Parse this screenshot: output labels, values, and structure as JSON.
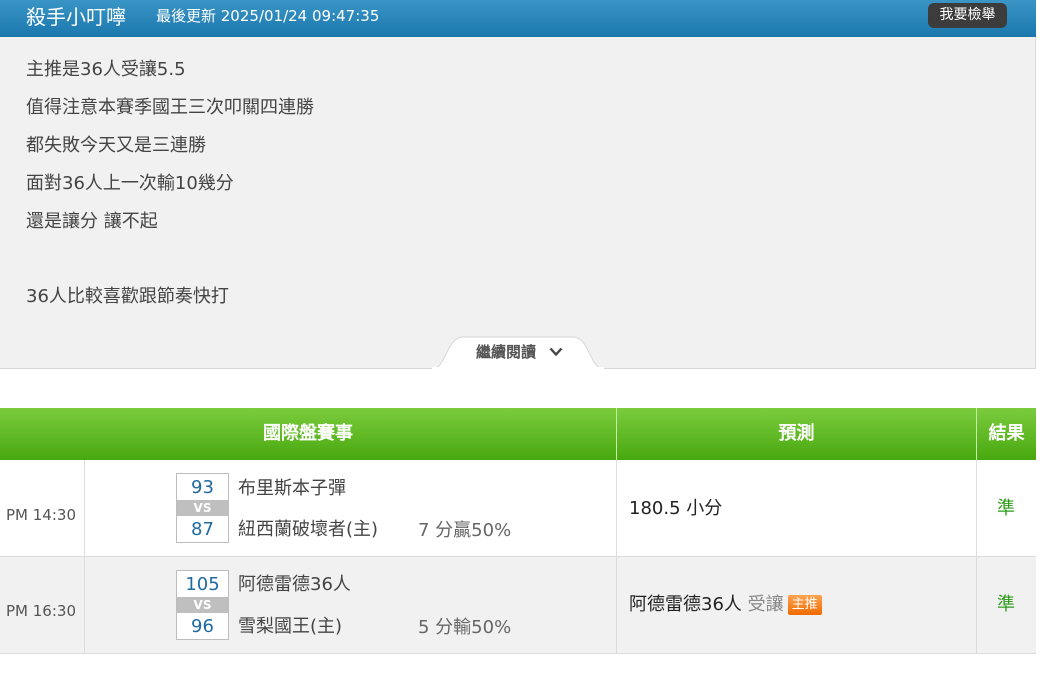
{
  "header": {
    "author": "殺手小叮嚀",
    "updated": "最後更新 2025/01/24 09:47:35",
    "report_button": "我要檢舉"
  },
  "article": {
    "lines": [
      "主推是36人受讓5.5",
      "值得注意本賽季國王三次叩關四連勝",
      "都失敗今天又是三連勝",
      "面對36人上一次輸10幾分",
      "還是讓分 讓不起",
      "36人比較喜歡跟節奏快打"
    ],
    "read_more": "繼續閱讀"
  },
  "table": {
    "headers": [
      "國際盤賽事",
      "預測",
      "結果"
    ],
    "colors": {
      "header_green": "#5cb81f",
      "result_green": "#2d9c1a",
      "badge_orange": "#f58220",
      "score_blue": "#1f6aa0"
    },
    "rows": [
      {
        "time": "PM 14:30",
        "away_score": "93",
        "vs": "VS",
        "home_score": "87",
        "away_team": "布里斯本子彈",
        "home_team": "紐西蘭破壞者(主)",
        "handicap": "7 分贏50%",
        "prediction": "180.5 小分",
        "prediction_note": "",
        "badge": "",
        "result": "準"
      },
      {
        "time": "PM 16:30",
        "away_score": "105",
        "vs": "VS",
        "home_score": "96",
        "away_team": "阿德雷德36人",
        "home_team": "雪梨國王(主)",
        "handicap": "5 分輸50%",
        "prediction": "阿德雷德36人",
        "prediction_note": "受讓",
        "badge": "主推",
        "result": "準"
      }
    ]
  }
}
